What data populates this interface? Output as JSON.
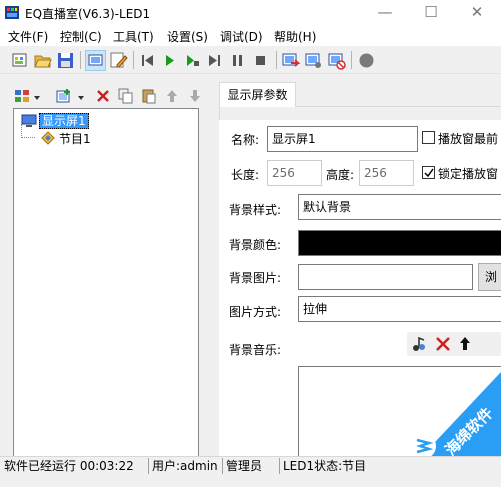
{
  "window": {
    "title": "EQ直播室(V6.3)-LED1",
    "min_glyph": "—",
    "max_glyph": "☐",
    "close_glyph": "✕"
  },
  "menu": [
    "文件(F)",
    "控制(C)",
    "工具(T)",
    "设置(S)",
    "调试(D)",
    "帮助(H)"
  ],
  "toolbar_icons": [
    "new-project-icon",
    "open-folder-icon",
    "save-icon",
    "screen-mode-icon",
    "edit-mode-icon",
    "skip-start-icon",
    "play-icon",
    "step-play-icon",
    "skip-end-icon",
    "pause-icon",
    "stop-icon",
    "send-icon",
    "send-settings-icon",
    "send-clear-icon",
    "record-icon"
  ],
  "left_toolbar_icons": [
    "layout-grid-icon",
    "add-item-icon",
    "dropdown-icon",
    "delete-icon",
    "copy-icon",
    "paste-icon",
    "move-up-icon",
    "move-down-icon"
  ],
  "tree": {
    "screen": "显示屏1",
    "program": "节目1"
  },
  "tab": "显示屏参数",
  "form": {
    "name_label": "名称:",
    "name_value": "显示屏1",
    "cb_play_window_label": "播放窗最前",
    "width_label": "长度:",
    "width_value": "256",
    "height_label": "高度:",
    "height_value": "256",
    "cb_lock_label": "锁定播放窗",
    "bg_style_label": "背景样式:",
    "bg_style_value": "默认背景",
    "bg_color_label": "背景颜色:",
    "bg_color_value": "#000000",
    "bg_image_label": "背景图片:",
    "bg_image_value": "",
    "browse_label": "浏",
    "fit_label": "图片方式:",
    "fit_value": "拉伸",
    "music_label": "背景音乐:"
  },
  "status": {
    "runtime": "软件已经运行 00:03:22",
    "user": "用户:admin",
    "role": "管理员",
    "led_state": "LED1状态:节目"
  },
  "watermark": {
    "text": "海绵软件"
  }
}
